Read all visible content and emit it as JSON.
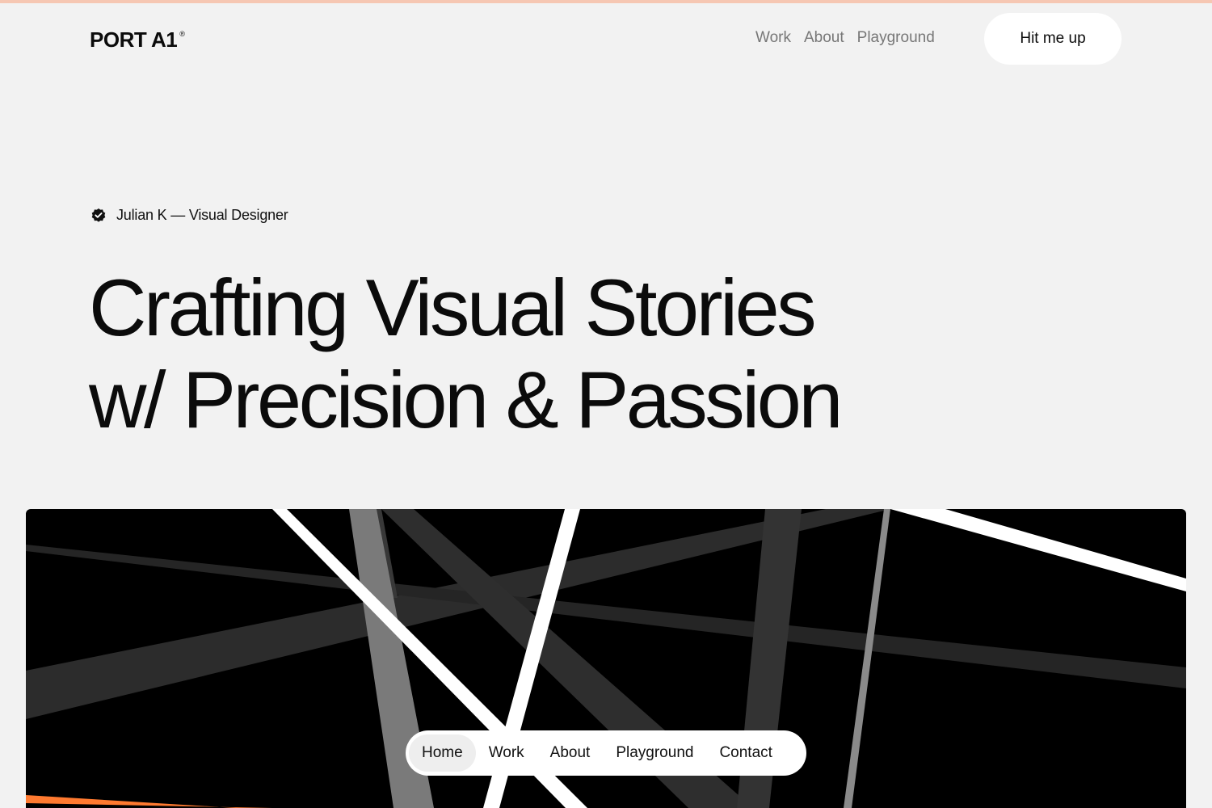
{
  "brand": {
    "name": "PORT A1",
    "mark": "®"
  },
  "topnav": {
    "items": [
      {
        "label": "Work"
      },
      {
        "label": "About"
      },
      {
        "label": "Playground"
      }
    ],
    "cta_label": "Hit me up"
  },
  "hero": {
    "tagline": "Julian K — Visual Designer",
    "headline_line1": "Crafting Visual Stories",
    "headline_line2": "w/ Precision & Passion"
  },
  "pill_nav": {
    "items": [
      {
        "label": "Home",
        "active": true
      },
      {
        "label": "Work",
        "active": false
      },
      {
        "label": "About",
        "active": false
      },
      {
        "label": "Playground",
        "active": false
      },
      {
        "label": "Contact",
        "active": false
      }
    ]
  },
  "colors": {
    "background": "#f2f2f2",
    "accent": "#ff7a30",
    "top_strip": "#f6c7b3",
    "text": "#0b0b0b",
    "muted_text": "#777777"
  },
  "icons": {
    "tagline_icon": "verified-badge-icon"
  }
}
